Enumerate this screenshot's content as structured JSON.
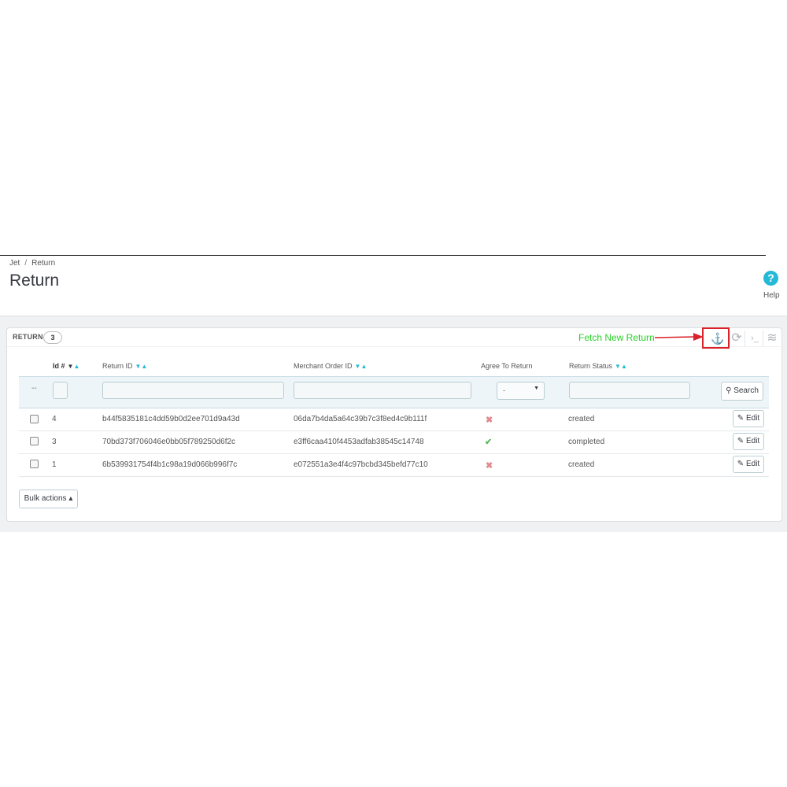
{
  "breadcrumb": {
    "items": [
      "Jet",
      "Return"
    ],
    "separator": "/"
  },
  "page_title": "Return",
  "help": {
    "icon": "question-circle-icon",
    "glyph": "?",
    "label": "Help"
  },
  "panel": {
    "title": "RETURN",
    "count": "3"
  },
  "annotation": {
    "text": "Fetch New Return",
    "color": "#28d228",
    "highlight_color": "#d9232a"
  },
  "toolbar": {
    "icons": [
      "anchor-icon",
      "refresh-icon",
      "terminal-icon",
      "database-icon"
    ],
    "glyphs": {
      "anchor": "⚓",
      "refresh": "⟳",
      "terminal": "›_",
      "database": "≋"
    }
  },
  "table": {
    "columns": [
      {
        "label": "Id #",
        "sort": true
      },
      {
        "label": "Return ID",
        "sort": true
      },
      {
        "label": "Merchant Order ID",
        "sort": true
      },
      {
        "label": "Agree To Return",
        "sort": false
      },
      {
        "label": "Return Status",
        "sort": true
      }
    ],
    "filter": {
      "bulk_placeholder": "--",
      "agree_select_value": "-",
      "search_label": "Search"
    },
    "rows": [
      {
        "id": "4",
        "return_id": "b44f5835181c4dd59b0d2ee701d9a43d",
        "merchant_order_id": "06da7b4da5a64c39b7c3f8ed4c9b111f",
        "agree": false,
        "agree_glyph": "✖",
        "status": "created",
        "edit_label": "Edit"
      },
      {
        "id": "3",
        "return_id": "70bd373f706046e0bb05f789250d6f2c",
        "merchant_order_id": "e3ff6caa410f4453adfab38545c14748",
        "agree": true,
        "agree_glyph": "✔",
        "status": "completed",
        "edit_label": "Edit"
      },
      {
        "id": "1",
        "return_id": "6b539931754f4b1c98a19d066b996f7c",
        "merchant_order_id": "e072551a3e4f4c97bcbd345befd77c10",
        "agree": false,
        "agree_glyph": "✖",
        "status": "created",
        "edit_label": "Edit"
      }
    ]
  },
  "bulk_actions": {
    "label": "Bulk actions ▴"
  },
  "colors": {
    "accent": "#25b9d7",
    "title": "#363a41",
    "success": "#5cb85c",
    "danger": "#e08b8f"
  }
}
